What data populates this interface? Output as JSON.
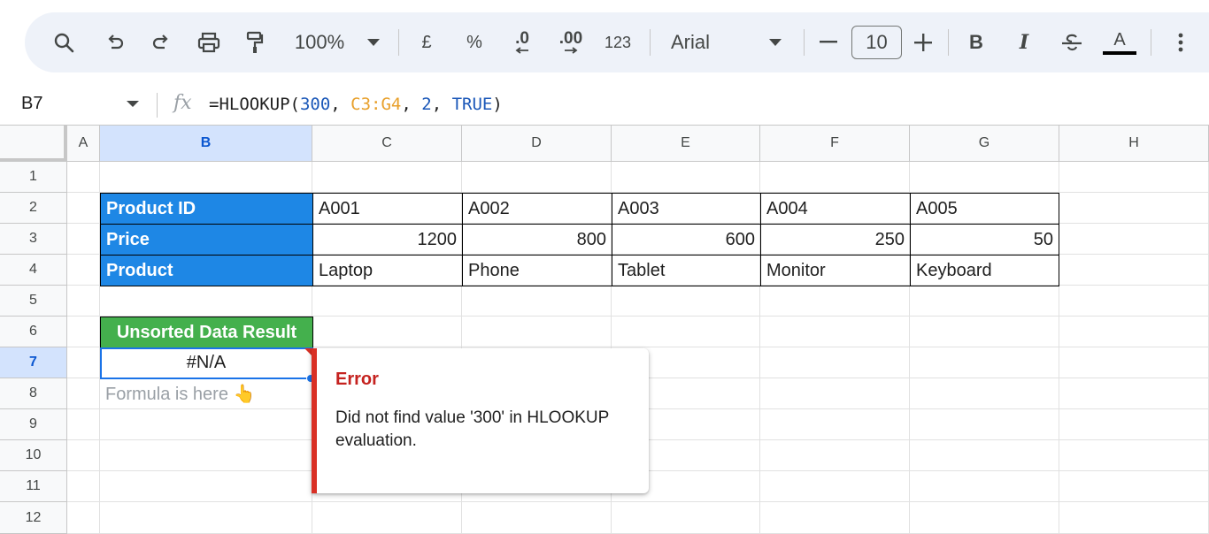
{
  "toolbar": {
    "zoom": "100%",
    "currency": "£",
    "percent": "%",
    "decrease_decimal": ".0",
    "increase_decimal": ".00",
    "more_formats": "123",
    "font": "Arial",
    "font_size": "10",
    "bold": "B",
    "italic": "I",
    "text_color": "A",
    "text_color_value": "#000000"
  },
  "formula_bar": {
    "cell_ref": "B7",
    "fx": "fx",
    "formula_parts": [
      "=HLOOKUP(",
      "300",
      ", ",
      "C3:G4",
      ", ",
      "2",
      ", ",
      "TRUE",
      ")"
    ]
  },
  "columns": [
    "A",
    "B",
    "C",
    "D",
    "E",
    "F",
    "G",
    "H"
  ],
  "rows": [
    "1",
    "2",
    "3",
    "4",
    "5",
    "6",
    "7",
    "8",
    "9",
    "10",
    "11",
    "12"
  ],
  "table": {
    "row_labels": [
      "Product ID",
      "Price",
      "Product"
    ],
    "product_ids": [
      "A001",
      "A002",
      "A003",
      "A004",
      "A005"
    ],
    "prices": [
      "1200",
      "800",
      "600",
      "250",
      "50"
    ],
    "products": [
      "Laptop",
      "Phone",
      "Tablet",
      "Monitor",
      "Keyboard"
    ]
  },
  "result": {
    "label": "Unsorted Data Result",
    "value": "#N/A",
    "hint": "Formula is here 👆"
  },
  "error_popup": {
    "title": "Error",
    "message": "Did not find value '300' in HLOOKUP evaluation."
  },
  "colors": {
    "header_blue": "#1e87e5",
    "result_green": "#44b04d",
    "error_red": "#d93025",
    "selection_blue": "#1a73e8"
  }
}
